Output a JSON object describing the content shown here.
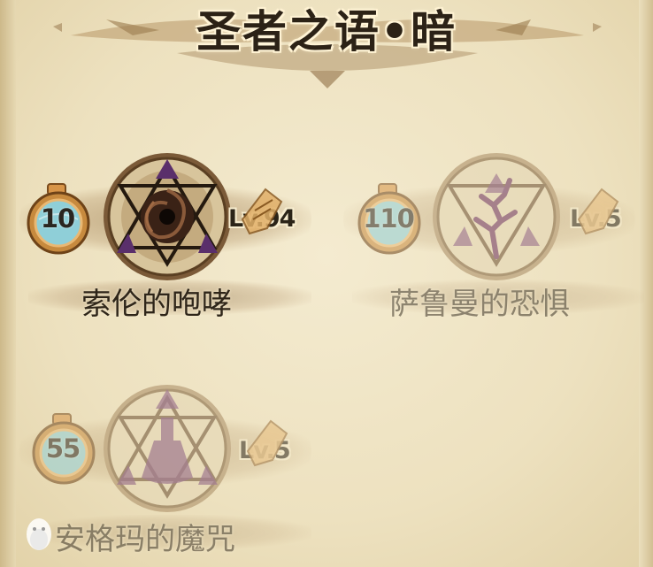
{
  "title": "圣者之语•暗",
  "skills": [
    {
      "name": "索伦的咆哮",
      "cost": "10",
      "level": "Lv.94",
      "state": "unlocked",
      "emblem": "dark-vortex-triangle-icon"
    },
    {
      "name": "萨鲁曼的恐惧",
      "cost": "110",
      "level": "Lv.5",
      "state": "locked",
      "emblem": "lightning-tree-triangle-icon"
    },
    {
      "name": "安格玛的魔咒",
      "cost": "55",
      "level": "Lv.5",
      "state": "locked",
      "emblem": "potion-flask-triangle-icon"
    }
  ],
  "colors": {
    "parchment": "#efe4c4",
    "ink": "#2c2216",
    "purple": "#5a2f6b",
    "flask_liquid": "#8fcfd8",
    "flask_rim": "#c78a3e"
  }
}
